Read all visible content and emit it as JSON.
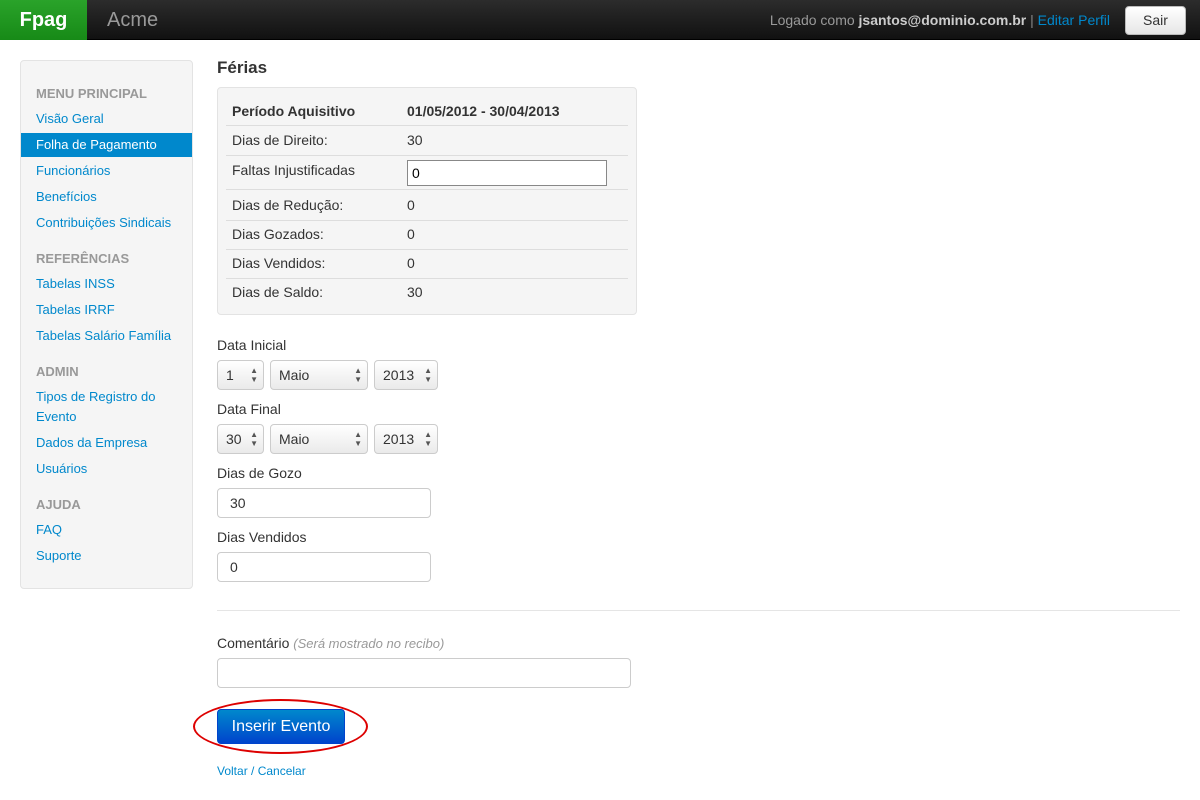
{
  "navbar": {
    "brand": "Fpag",
    "company": "Acme",
    "logged_as": "Logado como",
    "user": "jsantos@dominio.com.br",
    "separator": "|",
    "edit_profile": "Editar Perfil",
    "logout": "Sair"
  },
  "sidebar": {
    "sections": [
      {
        "header": "MENU PRINCIPAL",
        "items": [
          "Visão Geral",
          "Folha de Pagamento",
          "Funcionários",
          "Benefícios",
          "Contribuições Sindicais"
        ]
      },
      {
        "header": "REFERÊNCIAS",
        "items": [
          "Tabelas INSS",
          "Tabelas IRRF",
          "Tabelas Salário Família"
        ]
      },
      {
        "header": "ADMIN",
        "items": [
          "Tipos de Registro do",
          "Evento",
          "Dados da Empresa",
          "Usuários"
        ]
      },
      {
        "header": "AJUDA",
        "items": [
          "FAQ",
          "Suporte"
        ]
      }
    ],
    "active_item": "Folha de Pagamento"
  },
  "page": {
    "title": "Férias"
  },
  "summary": {
    "period_label": "Período Aquisitivo",
    "period_value": "01/05/2012 - 30/04/2013",
    "rows": [
      {
        "label": "Dias de Direito:",
        "value": "30"
      },
      {
        "label": "Faltas Injustificadas",
        "value": "0"
      },
      {
        "label": "Dias de Redução:",
        "value": "0"
      },
      {
        "label": "Dias Gozados:",
        "value": "0"
      },
      {
        "label": "Dias Vendidos:",
        "value": "0"
      },
      {
        "label": "Dias de Saldo:",
        "value": "30"
      }
    ]
  },
  "form": {
    "start_date_label": "Data Inicial",
    "start_day": "1",
    "start_month": "Maio",
    "start_year": "2013",
    "end_date_label": "Data Final",
    "end_day": "30",
    "end_month": "Maio",
    "end_year": "2013",
    "days_enjoy_label": "Dias de Gozo",
    "days_enjoy_value": "30",
    "days_sold_label": "Dias Vendidos",
    "days_sold_value": "0",
    "comment_label": "Comentário",
    "comment_hint": "(Será mostrado no recibo)",
    "comment_value": "",
    "submit": "Inserir Evento",
    "cancel": "Voltar / Cancelar"
  },
  "colors": {
    "brand_green": "#1f951f",
    "link_blue": "#0088cc",
    "primary_button": "#0055cc",
    "highlight_red": "#dd0000"
  }
}
